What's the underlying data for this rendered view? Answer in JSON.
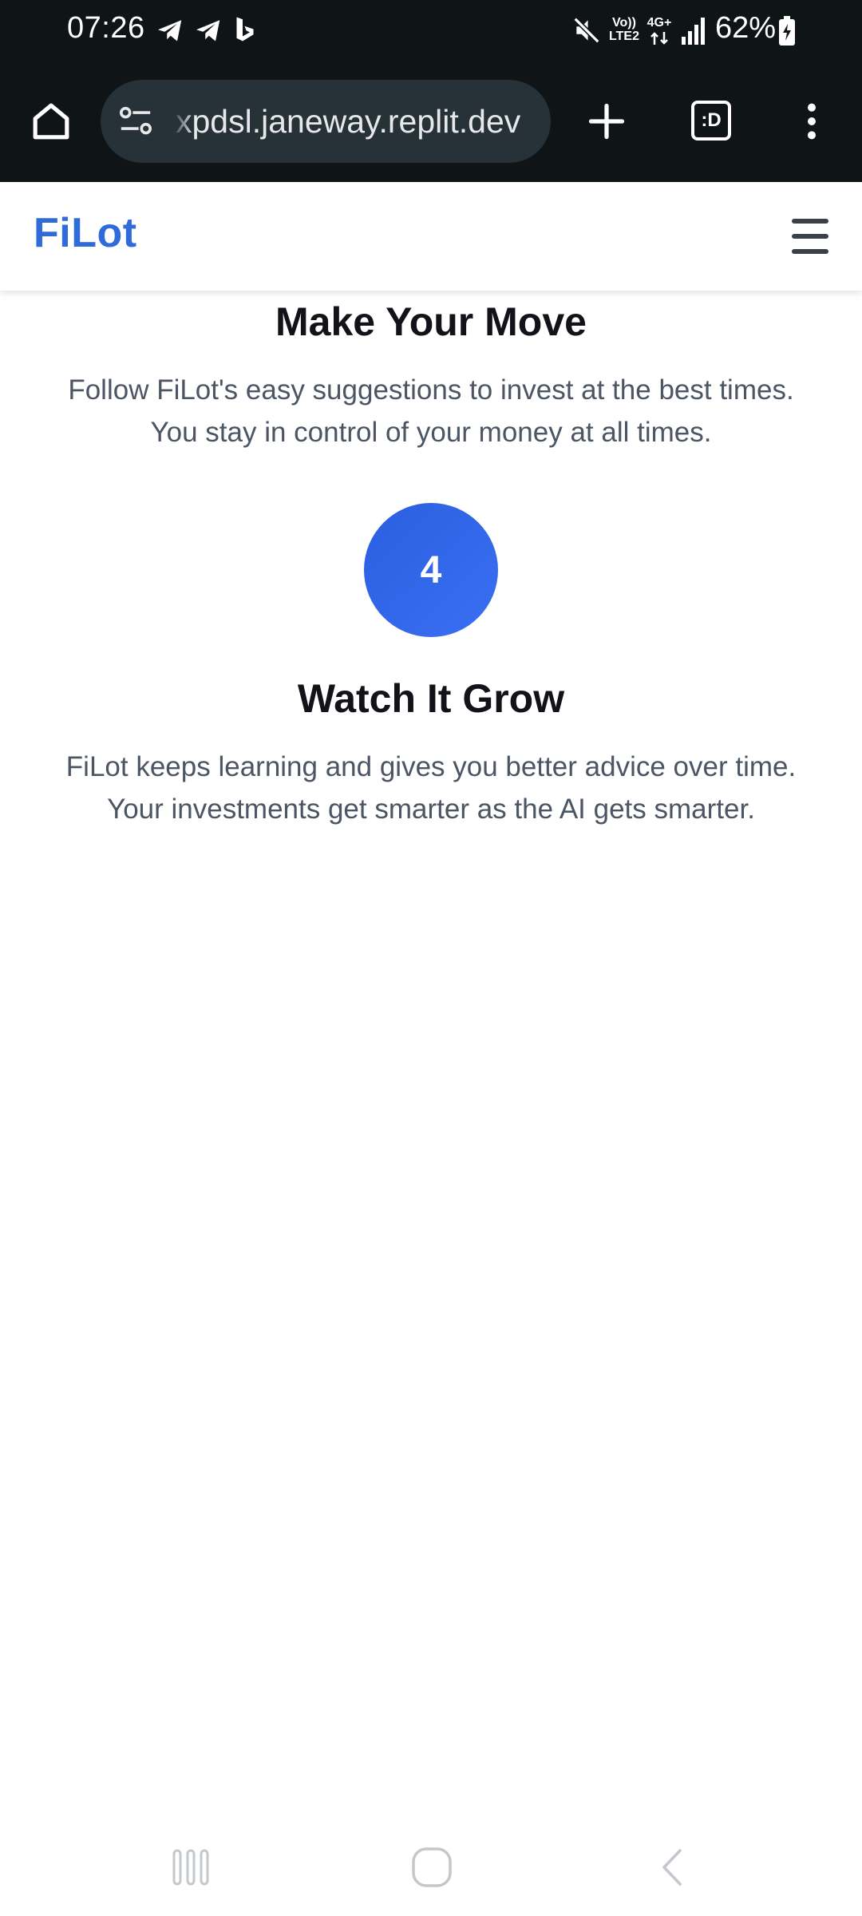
{
  "status_bar": {
    "time": "07:26",
    "notification_icons": [
      "telegram-icon",
      "telegram-icon",
      "bing-icon"
    ],
    "network_volte": "Vo))\nLTE2",
    "network_type": "4G+",
    "battery_percent": "62%",
    "icons": [
      "mute-icon",
      "signal-icon",
      "battery-charging-icon"
    ]
  },
  "browser": {
    "url": "xpdsl.janeway.replit.dev",
    "tab_switcher_label": ":D",
    "icons": [
      "home-icon",
      "site-settings-icon",
      "new-tab-icon",
      "tab-switcher-icon",
      "more-menu-icon"
    ]
  },
  "header": {
    "logo": "FiLot",
    "menu_icon": "hamburger-menu-icon",
    "brand_color": "#2f6bd9"
  },
  "steps": [
    {
      "title": "Make Your Move",
      "description_line1": "Follow FiLot's easy suggestions to invest at the best times.",
      "description_line2": "You stay in control of your money at all times."
    },
    {
      "number": "4",
      "title": "Watch It Grow",
      "description_line1": "FiLot keeps learning and gives you better advice over time.",
      "description_line2": "Your investments get smarter as the AI gets smarter."
    }
  ],
  "colors": {
    "badge": "#3366ee",
    "body_text": "#4b5563",
    "heading": "#111318"
  },
  "nav_bar": {
    "icons": [
      "recents-icon",
      "home-button-icon",
      "back-icon"
    ]
  }
}
